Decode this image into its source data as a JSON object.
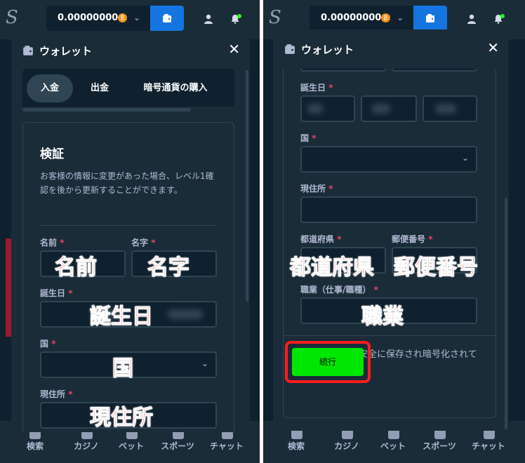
{
  "header": {
    "logo": "S",
    "balance": "0.00000000",
    "coin_glyph": "₿",
    "chevron": "⌄"
  },
  "modal": {
    "title": "ウォレット",
    "close": "✕"
  },
  "tabs": [
    {
      "label": "入金"
    },
    {
      "label": "出金"
    },
    {
      "label": "暗号通貨の購入"
    }
  ],
  "verification": {
    "heading": "検証",
    "description": "お客様の情報に変更があった場合、レベル1確認を後から更新することができます。"
  },
  "labels": {
    "first_name": "名前",
    "last_name": "名字",
    "birthdate": "誕生日",
    "country": "国",
    "address": "現住所",
    "prefecture": "都道府県",
    "postal_code": "郵便番号",
    "occupation": "職業（仕事/職種）",
    "required": "*"
  },
  "annotations": {
    "first_name": "名前",
    "last_name": "名字",
    "birthdate": "誕生日",
    "country": "国",
    "address": "現住所",
    "prefecture": "都道府県",
    "postal_code": "郵便番号",
    "occupation": "職業"
  },
  "security_note": "全てのデータは安全に保存され暗号化されています。",
  "continue_label": "続行",
  "bottom_nav": [
    {
      "label": "検索"
    },
    {
      "label": "カジノ"
    },
    {
      "label": "ベット"
    },
    {
      "label": "スポーツ"
    },
    {
      "label": "チャット"
    }
  ],
  "colors": {
    "background": "#0f212e",
    "panel": "#1a2c38",
    "border": "#2f4553",
    "accent_blue": "#1475e1",
    "accent_green": "#00e701",
    "required_red": "#ed4163",
    "annotation_red": "#ff1e1e"
  }
}
